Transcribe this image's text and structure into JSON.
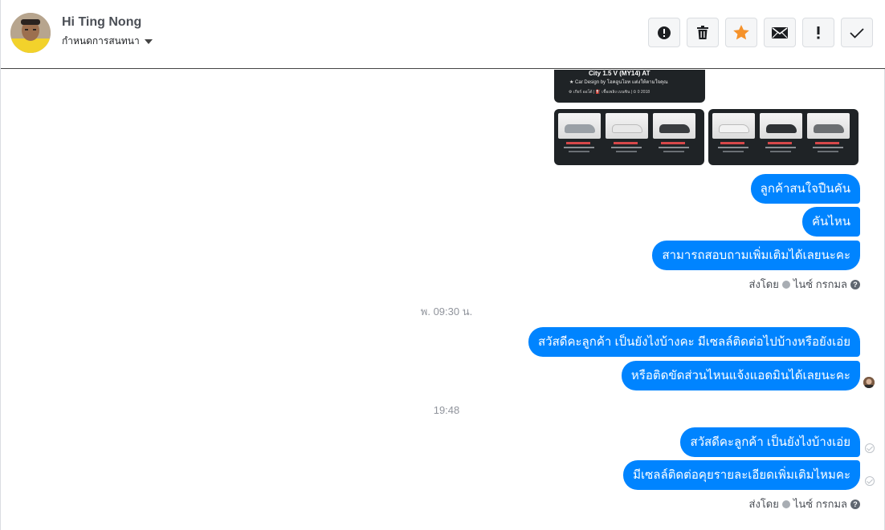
{
  "header": {
    "name": "Hi Ting Nong",
    "subtitle": "กำหนดการสนทนา",
    "tools": [
      {
        "name": "report-icon",
        "color": "#1c1e21"
      },
      {
        "name": "trash-icon",
        "color": "#1c1e21"
      },
      {
        "name": "star-icon",
        "color": "#f5922b"
      },
      {
        "name": "mail-icon",
        "color": "#1c1e21"
      },
      {
        "name": "important-icon",
        "color": "#1c1e21"
      },
      {
        "name": "done-check-icon",
        "color": "#1c1e21"
      }
    ]
  },
  "attachments": {
    "top_card": {
      "title": "City 1.5 V (MY14) AT",
      "subtitle": "★ Car Design by โฮคอูนโอท แต่งให้ตามใจคุณ",
      "specs": "⚙ เกียร์ ออโต้   |   ⛽ เชื้อเพลิง เบนซิน   |   ⏲ 0 2018"
    }
  },
  "messages": {
    "group1": [
      "ลูกค้าสนใจปืนคัน",
      "คันไหน",
      "สามารถสอบถามเพิ่มเติมได้เลยนะคะ"
    ],
    "meta1": {
      "prefix": "ส่งโดย",
      "sender": "ไนซ์ กรกมล"
    },
    "time1": "พ. 09:30 น.",
    "group2": [
      "สวัสดีคะลูกค้า เป็นยังไงบ้างคะ มีเซลล์ติดต่อไปบ้างหรือยังเอ่ย",
      "หรือติดขัดส่วนไหนแจ้งแอดมินได้เลยนะคะ"
    ],
    "time2": "19:48",
    "group3": [
      "สวัสดีคะลูกค้า เป็นยังไงบ้างเอ่ย",
      "มีเซลล์ติดต่อคุยรายละเอียดเพิ่มเติมไหมคะ"
    ],
    "meta2": {
      "prefix": "ส่งโดย",
      "sender": "ไนซ์ กรกมล"
    }
  },
  "colors": {
    "bubble": "#0084ff",
    "star": "#f5922b"
  }
}
